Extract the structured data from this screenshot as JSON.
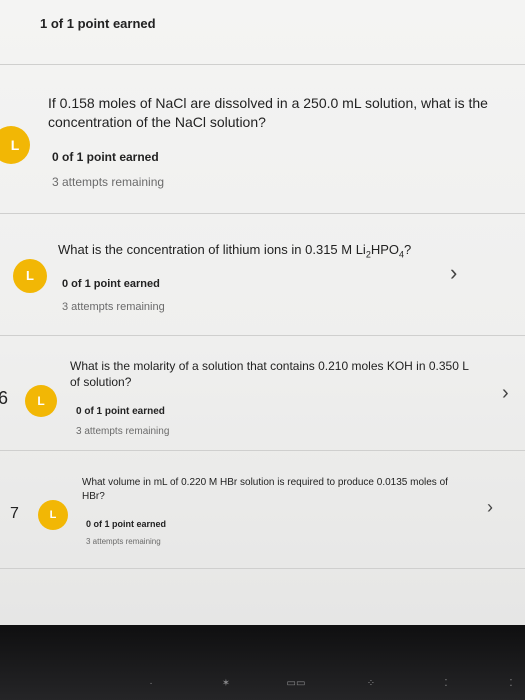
{
  "header": {
    "score": "1 of 1 point earned"
  },
  "questions": [
    {
      "text": "If 0.158 moles of NaCl are dissolved in a 250.0 mL solution, what is the concentration of the NaCl solution?",
      "score": "0 of 1 point earned",
      "attempts": "3 attempts remaining",
      "badge": "L"
    },
    {
      "text_before": "What is the concentration of lithium ions in 0.315 M Li",
      "sub1": "2",
      "text_mid": "HPO",
      "sub2": "4",
      "text_after": "?",
      "score": "0 of 1 point earned",
      "attempts": "3 attempts remaining",
      "badge": "L",
      "chevron": "›"
    },
    {
      "number": "6",
      "text": "What is the molarity of a solution that contains 0.210 moles KOH in 0.350 L of solution?",
      "score": "0 of 1 point earned",
      "attempts": "3 attempts remaining",
      "badge": "L",
      "chevron": "›"
    },
    {
      "number": "7",
      "text": "What volume in mL of 0.220 M HBr solution is required to produce 0.0135 moles of HBr?",
      "score": "0 of 1 point earned",
      "attempts": "3 attempts remaining",
      "badge": "L",
      "chevron": "›"
    }
  ],
  "colors": {
    "badge": "#f2b705",
    "background": "#f4f4f3",
    "divider": "#cfcfce"
  }
}
